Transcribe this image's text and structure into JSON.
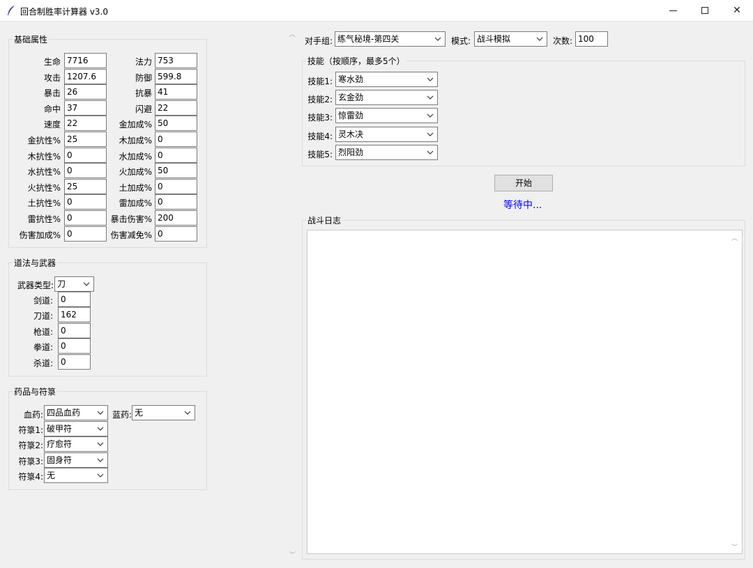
{
  "window": {
    "title": "回合制胜率计算器 v3.0",
    "minimize": "minimize",
    "maximize": "maximize",
    "close": "✕"
  },
  "basic": {
    "title": "基础属性",
    "left": [
      {
        "label": "生命",
        "value": "7716"
      },
      {
        "label": "攻击",
        "value": "1207.6"
      },
      {
        "label": "暴击",
        "value": "26"
      },
      {
        "label": "命中",
        "value": "37"
      },
      {
        "label": "速度",
        "value": "22"
      },
      {
        "label": "金抗性%",
        "value": "25"
      },
      {
        "label": "木抗性%",
        "value": "0"
      },
      {
        "label": "水抗性%",
        "value": "0"
      },
      {
        "label": "火抗性%",
        "value": "25"
      },
      {
        "label": "土抗性%",
        "value": "0"
      },
      {
        "label": "雷抗性%",
        "value": "0"
      },
      {
        "label": "伤害加成%",
        "value": "0"
      }
    ],
    "right": [
      {
        "label": "法力",
        "value": "753"
      },
      {
        "label": "防御",
        "value": "599.8"
      },
      {
        "label": "抗暴",
        "value": "41"
      },
      {
        "label": "闪避",
        "value": "22"
      },
      {
        "label": "金加成%",
        "value": "50"
      },
      {
        "label": "木加成%",
        "value": "0"
      },
      {
        "label": "水加成%",
        "value": "0"
      },
      {
        "label": "火加成%",
        "value": "50"
      },
      {
        "label": "土加成%",
        "value": "0"
      },
      {
        "label": "雷加成%",
        "value": "0"
      },
      {
        "label": "暴击伤害%",
        "value": "200"
      },
      {
        "label": "伤害减免%",
        "value": "0"
      }
    ]
  },
  "dao": {
    "title": "道法与武器",
    "weapon_label": "武器类型:",
    "weapon_value": "刀",
    "fields": [
      {
        "label": "剑道:",
        "value": "0"
      },
      {
        "label": "刀道:",
        "value": "162"
      },
      {
        "label": "枪道:",
        "value": "0"
      },
      {
        "label": "拳道:",
        "value": "0"
      },
      {
        "label": "杀道:",
        "value": "0"
      }
    ]
  },
  "meds": {
    "title": "药品与符箓",
    "hp_label": "血药:",
    "hp_value": "四品血药",
    "mp_label": "蓝药:",
    "mp_value": "无",
    "talismans": [
      {
        "label": "符箓1:",
        "value": "破甲符"
      },
      {
        "label": "符箓2:",
        "value": "疗愈符"
      },
      {
        "label": "符箓3:",
        "value": "固身符"
      },
      {
        "label": "符箓4:",
        "value": "无"
      }
    ]
  },
  "top": {
    "opponent_label": "对手组:",
    "opponent_value": "练气秘境-第四关",
    "mode_label": "模式:",
    "mode_value": "战斗模拟",
    "count_label": "次数:",
    "count_value": "100"
  },
  "skills": {
    "title": "技能（按顺序，最多5个）",
    "items": [
      {
        "label": "技能1:",
        "value": "寒水劲"
      },
      {
        "label": "技能2:",
        "value": "玄金劲"
      },
      {
        "label": "技能3:",
        "value": "惊雷劲"
      },
      {
        "label": "技能4:",
        "value": "灵木决"
      },
      {
        "label": "技能5:",
        "value": "烈阳劲"
      }
    ]
  },
  "start_label": "开始",
  "status_text": "等待中...",
  "log_title": "战斗日志",
  "colors": {
    "status": "#0000ff",
    "background": "#f0f0f0"
  }
}
